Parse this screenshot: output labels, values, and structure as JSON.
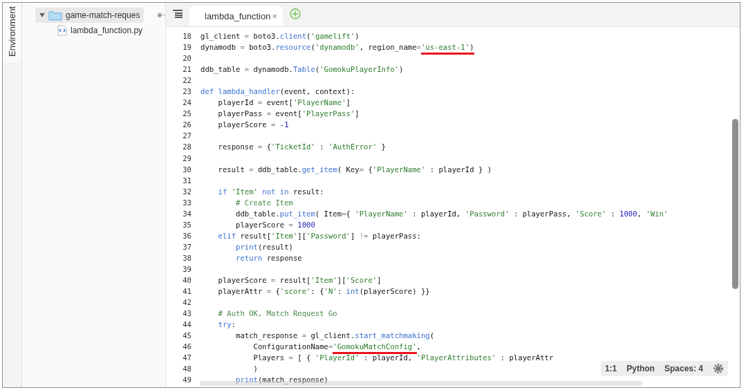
{
  "side_tab": {
    "label": "Environment",
    "selected": true
  },
  "tree": [
    {
      "label": "game-match-reques",
      "expanded": true,
      "selected": true,
      "kind": "folder",
      "children": [
        {
          "label": "lambda_function.py",
          "selected": false,
          "kind": "file"
        }
      ]
    }
  ],
  "tabs": [
    {
      "label": "lambda_function",
      "close": "×",
      "selected": true
    }
  ],
  "code_lines": [
    {
      "number": "18",
      "tokens": [
        {
          "kind": "plain",
          "text": "gl_client "
        },
        {
          "kind": "operator",
          "text": "="
        },
        {
          "kind": "plain",
          "text": " boto3."
        },
        {
          "kind": "function",
          "text": "client"
        },
        {
          "kind": "plain",
          "text": "("
        },
        {
          "kind": "string",
          "text": "'gamelift'"
        },
        {
          "kind": "plain",
          "text": ")"
        }
      ]
    },
    {
      "number": "19",
      "tokens": [
        {
          "kind": "plain",
          "text": "dynamodb "
        },
        {
          "kind": "operator",
          "text": "="
        },
        {
          "kind": "plain",
          "text": " boto3."
        },
        {
          "kind": "function",
          "text": "resource"
        },
        {
          "kind": "plain",
          "text": "("
        },
        {
          "kind": "string",
          "text": "'dynamodb'"
        },
        {
          "kind": "plain",
          "text": ", region_name"
        },
        {
          "kind": "operator",
          "text": "="
        },
        {
          "kind": "string",
          "text": "'us-east-1'",
          "underlined": true
        },
        {
          "kind": "plain",
          "text": ")",
          "underlined": true
        }
      ]
    },
    {
      "number": "20"
    },
    {
      "number": "21",
      "tokens": [
        {
          "kind": "plain",
          "text": "ddb_table "
        },
        {
          "kind": "operator",
          "text": "="
        },
        {
          "kind": "plain",
          "text": " dynamodb."
        },
        {
          "kind": "function",
          "text": "Table"
        },
        {
          "kind": "plain",
          "text": "("
        },
        {
          "kind": "string",
          "text": "'GomokuPlayerInfo'"
        },
        {
          "kind": "plain",
          "text": ")"
        }
      ]
    },
    {
      "number": "22"
    },
    {
      "number": "23",
      "tokens": [
        {
          "kind": "keyword",
          "text": "def"
        },
        {
          "kind": "function",
          "text": " lambda_handler"
        },
        {
          "kind": "plain",
          "text": "(event, context):"
        }
      ]
    },
    {
      "number": "24",
      "tokens": [
        {
          "kind": "plain",
          "text": "    playerId "
        },
        {
          "kind": "operator",
          "text": "="
        },
        {
          "kind": "plain",
          "text": " event["
        },
        {
          "kind": "string",
          "text": "'PlayerName'"
        },
        {
          "kind": "plain",
          "text": "]"
        }
      ]
    },
    {
      "number": "25",
      "tokens": [
        {
          "kind": "plain",
          "text": "    playerPass "
        },
        {
          "kind": "operator",
          "text": "="
        },
        {
          "kind": "plain",
          "text": " event["
        },
        {
          "kind": "string",
          "text": "'PlayerPass'"
        },
        {
          "kind": "plain",
          "text": "]"
        }
      ]
    },
    {
      "number": "26",
      "tokens": [
        {
          "kind": "plain",
          "text": "    playerScore "
        },
        {
          "kind": "operator",
          "text": "="
        },
        {
          "kind": "number",
          "text": " -1"
        }
      ]
    },
    {
      "number": "27"
    },
    {
      "number": "28",
      "tokens": [
        {
          "kind": "plain",
          "text": "    response "
        },
        {
          "kind": "operator",
          "text": "="
        },
        {
          "kind": "plain",
          "text": " {"
        },
        {
          "kind": "string",
          "text": "'TicketId'"
        },
        {
          "kind": "plain",
          "text": " : "
        },
        {
          "kind": "string",
          "text": "'AuthError'"
        },
        {
          "kind": "plain",
          "text": " }"
        }
      ]
    },
    {
      "number": "29"
    },
    {
      "number": "30",
      "tokens": [
        {
          "kind": "plain",
          "text": "    result "
        },
        {
          "kind": "operator",
          "text": "="
        },
        {
          "kind": "plain",
          "text": " ddb_table."
        },
        {
          "kind": "function",
          "text": "get_item"
        },
        {
          "kind": "plain",
          "text": "( Key"
        },
        {
          "kind": "operator",
          "text": "="
        },
        {
          "kind": "plain",
          "text": " {"
        },
        {
          "kind": "string",
          "text": "'PlayerName'"
        },
        {
          "kind": "plain",
          "text": " : playerId } )"
        }
      ]
    },
    {
      "number": "31"
    },
    {
      "number": "32",
      "tokens": [
        {
          "kind": "keyword",
          "text": "    if"
        },
        {
          "kind": "string",
          "text": " 'Item'"
        },
        {
          "kind": "keyword",
          "text": " not in"
        },
        {
          "kind": "plain",
          "text": " result:"
        }
      ]
    },
    {
      "number": "33",
      "tokens": [
        {
          "kind": "comment",
          "text": "        # Create Item"
        }
      ]
    },
    {
      "number": "34",
      "tokens": [
        {
          "kind": "plain",
          "text": "        ddb_table."
        },
        {
          "kind": "function",
          "text": "put_item"
        },
        {
          "kind": "plain",
          "text": "( Item"
        },
        {
          "kind": "operator",
          "text": "="
        },
        {
          "kind": "plain",
          "text": "{ "
        },
        {
          "kind": "string",
          "text": "'PlayerName'"
        },
        {
          "kind": "plain",
          "text": " : playerId, "
        },
        {
          "kind": "string",
          "text": "'Password'"
        },
        {
          "kind": "plain",
          "text": " : playerPass, "
        },
        {
          "kind": "string",
          "text": "'Score'"
        },
        {
          "kind": "plain",
          "text": " : "
        },
        {
          "kind": "number",
          "text": "1000"
        },
        {
          "kind": "plain",
          "text": ", "
        },
        {
          "kind": "string",
          "text": "'Win'"
        }
      ]
    },
    {
      "number": "35",
      "tokens": [
        {
          "kind": "plain",
          "text": "        playerScore "
        },
        {
          "kind": "operator",
          "text": "="
        },
        {
          "kind": "number",
          "text": " 1000"
        }
      ]
    },
    {
      "number": "36",
      "tokens": [
        {
          "kind": "keyword",
          "text": "    elif"
        },
        {
          "kind": "plain",
          "text": " result["
        },
        {
          "kind": "string",
          "text": "'Item'"
        },
        {
          "kind": "plain",
          "text": "]["
        },
        {
          "kind": "string",
          "text": "'Password'"
        },
        {
          "kind": "plain",
          "text": "] "
        },
        {
          "kind": "operator",
          "text": "!="
        },
        {
          "kind": "plain",
          "text": " playerPass:"
        }
      ]
    },
    {
      "number": "37",
      "tokens": [
        {
          "kind": "keyword",
          "text": "        print"
        },
        {
          "kind": "plain",
          "text": "(result)"
        }
      ]
    },
    {
      "number": "38",
      "tokens": [
        {
          "kind": "keyword",
          "text": "        return"
        },
        {
          "kind": "plain",
          "text": " response"
        }
      ]
    },
    {
      "number": "39"
    },
    {
      "number": "40",
      "tokens": [
        {
          "kind": "plain",
          "text": "    playerScore "
        },
        {
          "kind": "operator",
          "text": "="
        },
        {
          "kind": "plain",
          "text": " result["
        },
        {
          "kind": "string",
          "text": "'Item'"
        },
        {
          "kind": "plain",
          "text": "]["
        },
        {
          "kind": "string",
          "text": "'Score'"
        },
        {
          "kind": "plain",
          "text": "]"
        }
      ]
    },
    {
      "number": "41",
      "tokens": [
        {
          "kind": "plain",
          "text": "    playerAttr "
        },
        {
          "kind": "operator",
          "text": "="
        },
        {
          "kind": "plain",
          "text": " {"
        },
        {
          "kind": "string",
          "text": "'score'"
        },
        {
          "kind": "plain",
          "text": ": {"
        },
        {
          "kind": "string",
          "text": "'N'"
        },
        {
          "kind": "plain",
          "text": ": "
        },
        {
          "kind": "keyword",
          "text": "int"
        },
        {
          "kind": "plain",
          "text": "(playerScore) }}"
        }
      ]
    },
    {
      "number": "42"
    },
    {
      "number": "43",
      "tokens": [
        {
          "kind": "comment",
          "text": "    # Auth OK, Match Request Go"
        }
      ]
    },
    {
      "number": "44",
      "tokens": [
        {
          "kind": "keyword",
          "text": "    try"
        },
        {
          "kind": "plain",
          "text": ":"
        }
      ]
    },
    {
      "number": "45",
      "tokens": [
        {
          "kind": "plain",
          "text": "        match_response "
        },
        {
          "kind": "operator",
          "text": "="
        },
        {
          "kind": "plain",
          "text": " gl_client."
        },
        {
          "kind": "function",
          "text": "start_matchmaking"
        },
        {
          "kind": "plain",
          "text": "("
        }
      ]
    },
    {
      "number": "46",
      "tokens": [
        {
          "kind": "plain",
          "text": "            ConfigurationName"
        },
        {
          "kind": "operator",
          "text": "="
        },
        {
          "kind": "string",
          "text": "'GomokuMatchConfig'",
          "underlined": true
        },
        {
          "kind": "plain",
          "text": ","
        }
      ]
    },
    {
      "number": "47",
      "tokens": [
        {
          "kind": "plain",
          "text": "            Players "
        },
        {
          "kind": "operator",
          "text": "="
        },
        {
          "kind": "plain",
          "text": " [ { "
        },
        {
          "kind": "string",
          "text": "'PlayerId'"
        },
        {
          "kind": "plain",
          "text": " : playerId, "
        },
        {
          "kind": "string",
          "text": "'PlayerAttributes'"
        },
        {
          "kind": "plain",
          "text": " : playerAttr"
        }
      ]
    },
    {
      "number": "48",
      "tokens": [
        {
          "kind": "plain",
          "text": "            )"
        }
      ]
    },
    {
      "number": "49",
      "tokens": [
        {
          "kind": "keyword",
          "text": "        print"
        },
        {
          "kind": "plain",
          "text": "(match_response)"
        }
      ]
    }
  ],
  "status": {
    "position": "1:1",
    "language": "Python",
    "indentation": "Spaces: 4"
  }
}
